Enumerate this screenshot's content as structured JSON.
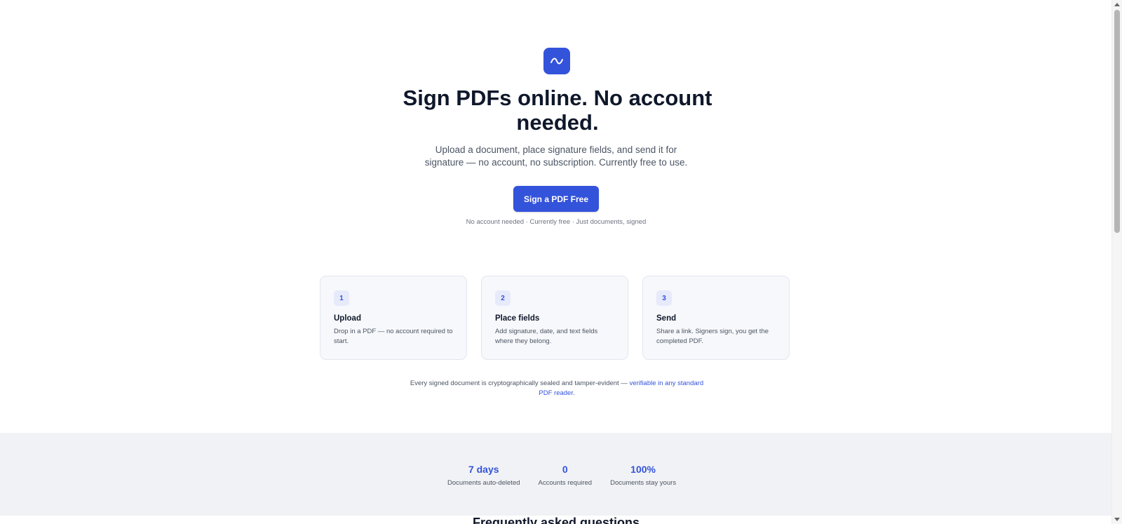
{
  "hero": {
    "logo_icon": "signature-wave-icon",
    "title": "Sign PDFs online. No account needed.",
    "subtitle": "Upload a document, place signature fields, and send it for signature — no account, no subscription. Currently free to use.",
    "cta_label": "Sign a PDF Free",
    "cta_note": "No account needed · Currently free · Just documents, signed"
  },
  "steps": [
    {
      "number": "1",
      "title": "Upload",
      "description": "Drop in a PDF — no account required to start."
    },
    {
      "number": "2",
      "title": "Place fields",
      "description": "Add signature, date, and text fields where they belong."
    },
    {
      "number": "3",
      "title": "Send",
      "description": "Share a link. Signers sign, you get the completed PDF."
    }
  ],
  "seal_note": {
    "text": "Every signed document is cryptographically sealed and tamper-evident — ",
    "link_text": "verifiable in any standard PDF reader."
  },
  "stats": [
    {
      "value": "7 days",
      "label": "Documents auto-deleted"
    },
    {
      "value": "0",
      "label": "Accounts required"
    },
    {
      "value": "100%",
      "label": "Documents stay yours"
    }
  ],
  "faq": {
    "title": "Frequently asked questions"
  },
  "colors": {
    "accent": "#3453db",
    "heading": "#0f172a",
    "body_text": "#4b5563",
    "card_bg": "#f7f8fb",
    "stats_bg": "#f1f2f5"
  }
}
